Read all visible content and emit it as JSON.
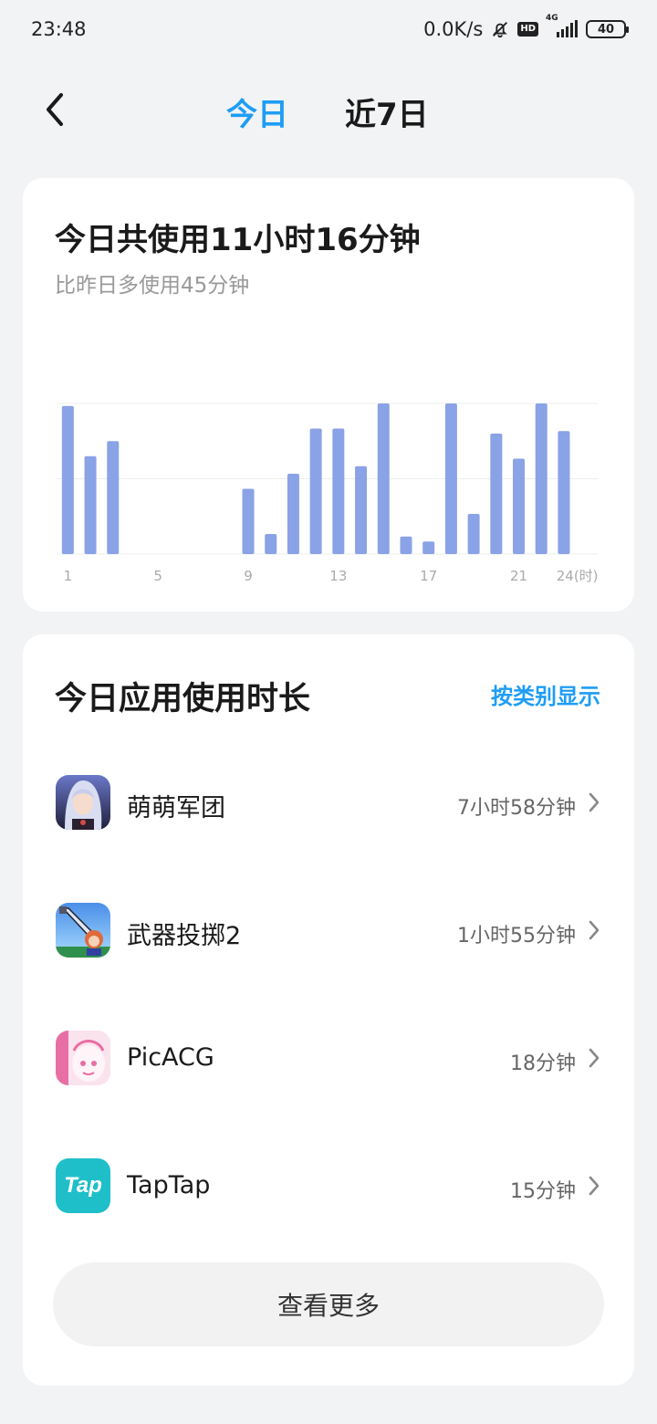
{
  "status_bar": {
    "time": "23:48",
    "net_speed": "0.0K/s",
    "hd_label": "HD",
    "network_label": "4G",
    "battery": "40",
    "icons": [
      "mute-bell-icon",
      "hd-icon",
      "signal-icon",
      "battery-icon"
    ]
  },
  "nav": {
    "back_icon": "chevron-left-icon",
    "tabs": [
      {
        "label": "今日",
        "active": true
      },
      {
        "label": "近7日",
        "active": false
      }
    ]
  },
  "summary": {
    "title": "今日共使用11小时16分钟",
    "subtitle": "比昨日多使用45分钟"
  },
  "chart_data": {
    "type": "bar",
    "categories": [
      "1",
      "2",
      "3",
      "4",
      "5",
      "6",
      "7",
      "8",
      "9",
      "10",
      "11",
      "12",
      "13",
      "14",
      "15",
      "16",
      "17",
      "18",
      "19",
      "20",
      "21",
      "22",
      "23",
      "24"
    ],
    "values": [
      59,
      39,
      45,
      0,
      0,
      0,
      0,
      0,
      26,
      8,
      32,
      50,
      50,
      35,
      60,
      7,
      5,
      60,
      16,
      48,
      38,
      60,
      49,
      0
    ],
    "x_tick_labels": [
      "1",
      "5",
      "9",
      "13",
      "17",
      "21",
      "24(时)"
    ],
    "ylim": [
      0,
      60
    ],
    "grid": true,
    "bar_color": "#8aa2e6"
  },
  "apps_section": {
    "title": "今日应用使用时长",
    "category_link": "按类别显示",
    "items": [
      {
        "name": "萌萌军团",
        "time": "7小时58分钟",
        "icon": "game-girl-icon"
      },
      {
        "name": "武器投掷2",
        "time": "1小时55分钟",
        "icon": "pixel-sword-icon"
      },
      {
        "name": "PicACG",
        "time": "18分钟",
        "icon": "picacg-icon"
      },
      {
        "name": "TapTap",
        "time": "15分钟",
        "icon": "taptap-icon",
        "icon_text": "Tap"
      }
    ],
    "more_button": "查看更多"
  },
  "colors": {
    "accent": "#1e9df5",
    "background": "#f2f3f5",
    "card": "#ffffff",
    "taptap": "#1ebfc8"
  }
}
